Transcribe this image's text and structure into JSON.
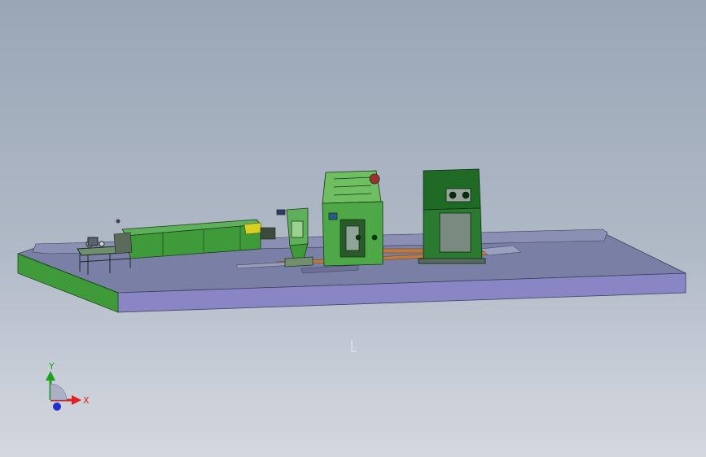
{
  "viewport": {
    "background_top": "#9aa6b6",
    "background_bottom": "#d3d7de"
  },
  "scene": {
    "platform_top_color": "#7a7fa6",
    "platform_front_color": "#8a85c4",
    "platform_side_color": "#3f9a3a",
    "machine_green": "#3f9a3a",
    "machine_dark_green": "#1f6b26",
    "rail_color": "#c07a3a"
  },
  "triad": {
    "x_label": "X",
    "y_label": "Y",
    "x_color": "#e02020",
    "y_color": "#20a020",
    "z_color": "#2030d0"
  }
}
